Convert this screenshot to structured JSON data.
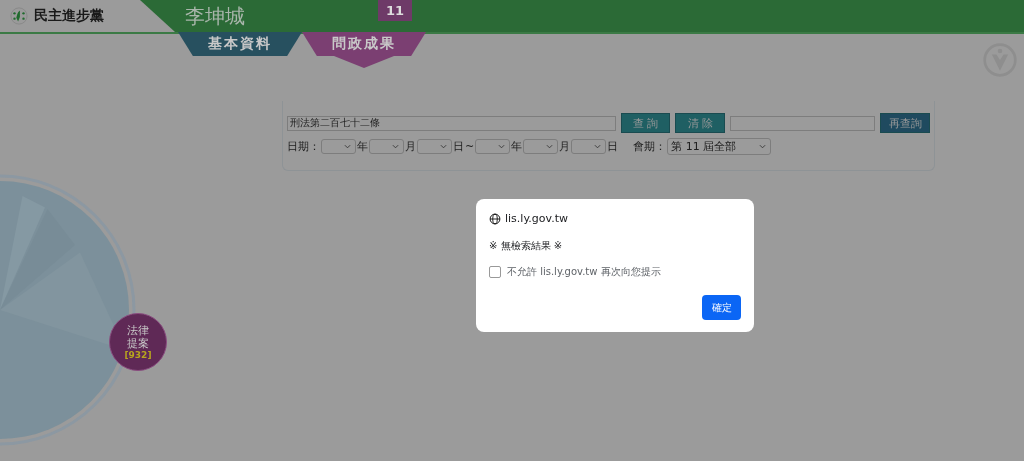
{
  "header": {
    "party": "民主進步黨",
    "name": "李坤城",
    "term": "11"
  },
  "tabs": [
    {
      "label": "基本資料",
      "selected": false
    },
    {
      "label": "問政成果",
      "selected": true
    }
  ],
  "search": {
    "query": "刑法第二百七十二條",
    "search_button": "查 詢",
    "clear_button": "清 除",
    "refine_button": "再查詢",
    "date_label": "日期：",
    "start_units": [
      "年",
      "月",
      "日"
    ],
    "separator": "~",
    "end_units": [
      "年",
      "月",
      "日"
    ],
    "session_label": "會期：",
    "session_value": "第 11 屆全部"
  },
  "bubble": {
    "lines": [
      "法律",
      "提案"
    ],
    "count": "[932]"
  },
  "dialog": {
    "origin": "lis.ly.gov.tw",
    "message": "※ 無檢索結果 ※",
    "checkbox": {
      "label": "不允許 lis.ly.gov.tw 再次向您提示",
      "checked": false
    },
    "button": "確定"
  }
}
